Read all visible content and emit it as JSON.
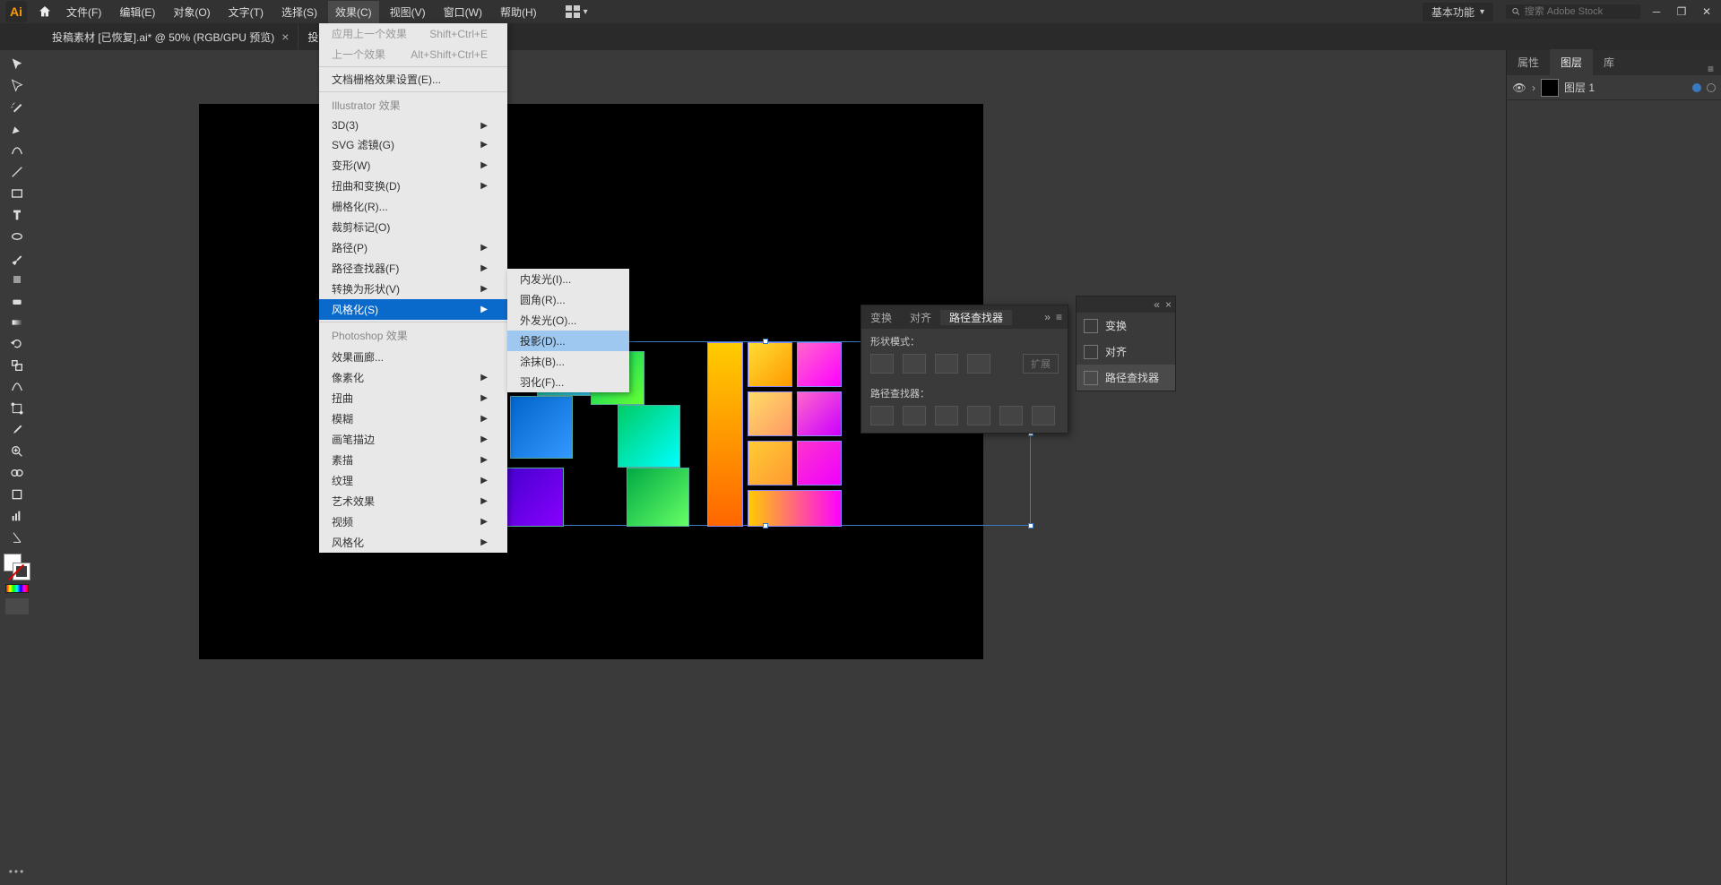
{
  "menubar": {
    "items": [
      "文件(F)",
      "编辑(E)",
      "对象(O)",
      "文字(T)",
      "选择(S)",
      "效果(C)",
      "视图(V)",
      "窗口(W)",
      "帮助(H)"
    ],
    "activeIndex": 5,
    "workspace": "基本功能",
    "searchPlaceholder": "搜索 Adobe Stock"
  },
  "tabs": [
    {
      "label": "投稿素材  [已恢复].ai* @ 50% (RGB/GPU 预览)"
    },
    {
      "label": "投                                        GPU 预览)"
    }
  ],
  "effectsMenu": {
    "applyLast": {
      "label": "应用上一个效果",
      "shortcut": "Shift+Ctrl+E"
    },
    "lastEffect": {
      "label": "上一个效果",
      "shortcut": "Alt+Shift+Ctrl+E"
    },
    "docRaster": "文档栅格效果设置(E)...",
    "sectionIllustrator": "Illustrator 效果",
    "items1": [
      "3D(3)",
      "SVG 滤镜(G)",
      "变形(W)",
      "扭曲和变换(D)",
      "栅格化(R)...",
      "裁剪标记(O)",
      "路径(P)",
      "路径查找器(F)",
      "转换为形状(V)",
      "风格化(S)"
    ],
    "sectionPhotoshop": "Photoshop 效果",
    "items2": [
      "效果画廊...",
      "像素化",
      "扭曲",
      "模糊",
      "画笔描边",
      "素描",
      "纹理",
      "艺术效果",
      "视频",
      "风格化"
    ]
  },
  "stylizeSub": [
    "内发光(I)...",
    "圆角(R)...",
    "外发光(O)...",
    "投影(D)...",
    "涂抹(B)...",
    "羽化(F)..."
  ],
  "stylizeHighlightIndex": 3,
  "rightPanel": {
    "tabs": [
      "属性",
      "图层",
      "库"
    ],
    "activeTab": 1,
    "layerName": "图层 1"
  },
  "pathfinder": {
    "tabs": [
      "变换",
      "对齐",
      "路径查找器"
    ],
    "activeTab": 2,
    "shapeModes": "形状模式：",
    "pathfinders": "路径查找器：",
    "expand": "扩展"
  },
  "miniPanel": {
    "items": [
      "变换",
      "对齐",
      "路径查找器"
    ],
    "activeIndex": 2
  }
}
